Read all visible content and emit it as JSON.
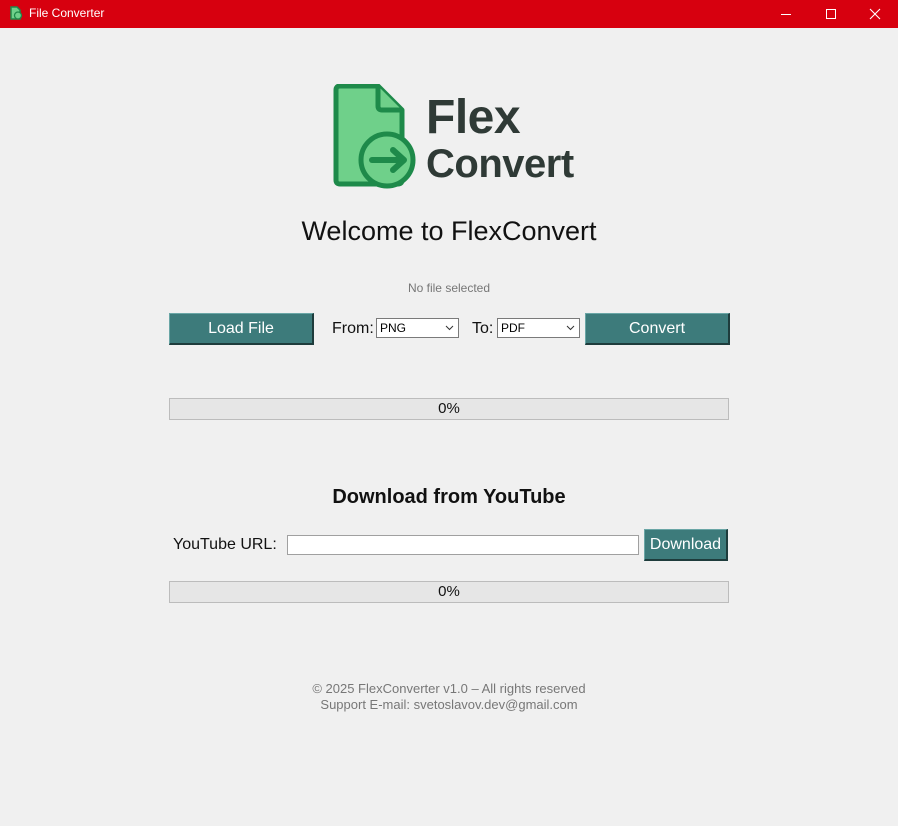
{
  "window": {
    "title": "File Converter",
    "accent": "#d7000f"
  },
  "logo": {
    "line1": "Flex",
    "line2": "Convert",
    "icon": "file-convert-logo-icon",
    "colors": {
      "dark_green": "#1e8a4a",
      "light_green": "#6fd08a",
      "text": "#2f3a36"
    }
  },
  "welcome": "Welcome to FlexConvert",
  "file_status": "No file selected",
  "converter": {
    "load_label": "Load File",
    "from_label": "From:",
    "from_value": "PNG",
    "to_label": "To:",
    "to_value": "PDF",
    "convert_label": "Convert",
    "progress": 0,
    "progress_text": "0%"
  },
  "youtube": {
    "title": "Download from YouTube",
    "url_label": "YouTube URL:",
    "url_value": "",
    "download_label": "Download",
    "progress": 0,
    "progress_text": "0%"
  },
  "footer": {
    "copyright": "© 2025 FlexConverter v1.0 – All rights reserved",
    "support": "Support E-mail: svetoslavov.dev@gmail.com"
  },
  "theme": {
    "button": "#3d7b7b",
    "background": "#f0f0f0"
  }
}
